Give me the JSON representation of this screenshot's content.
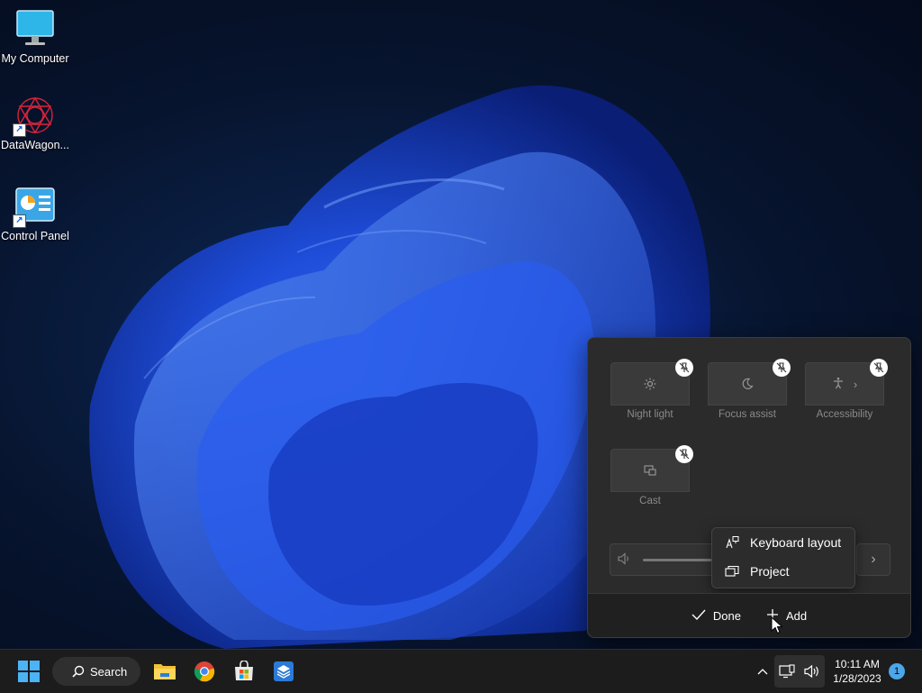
{
  "desktop": {
    "icons": [
      {
        "label": "My Computer",
        "icon": "monitor-icon"
      },
      {
        "label": "DataWagon...",
        "icon": "datawagon-app-icon"
      },
      {
        "label": "Control Panel",
        "icon": "control-panel-icon"
      }
    ]
  },
  "quick_settings": {
    "mode": "edit",
    "tiles": [
      {
        "label": "Night light",
        "icon": "brightness-icon",
        "pinned": true
      },
      {
        "label": "Focus assist",
        "icon": "moon-icon",
        "pinned": true
      },
      {
        "label": "Accessibility",
        "icon": "accessibility-icon",
        "pinned": true,
        "chevron": "›"
      },
      {
        "label": "Cast",
        "icon": "cast-icon",
        "pinned": true
      }
    ],
    "volume": {
      "icon": "speaker-icon",
      "next": "›"
    },
    "add_menu": [
      {
        "label": "Keyboard layout",
        "icon": "keyboard-layout-icon"
      },
      {
        "label": "Project",
        "icon": "project-icon"
      }
    ],
    "footer": {
      "done_label": "Done",
      "add_label": "Add"
    }
  },
  "taskbar": {
    "search_label": "Search",
    "apps": [
      "start-icon",
      "file-explorer-icon",
      "chrome-icon",
      "microsoft-store-icon",
      "app-icon"
    ],
    "tray": {
      "time": "10:11 AM",
      "date": "1/28/2023",
      "notification_count": "1"
    }
  },
  "colors": {
    "accent": "#1f5fd6",
    "panel_bg": "#2b2b2b",
    "taskbar_bg": "#1c1c1c",
    "badge": "#4ca6e8"
  }
}
